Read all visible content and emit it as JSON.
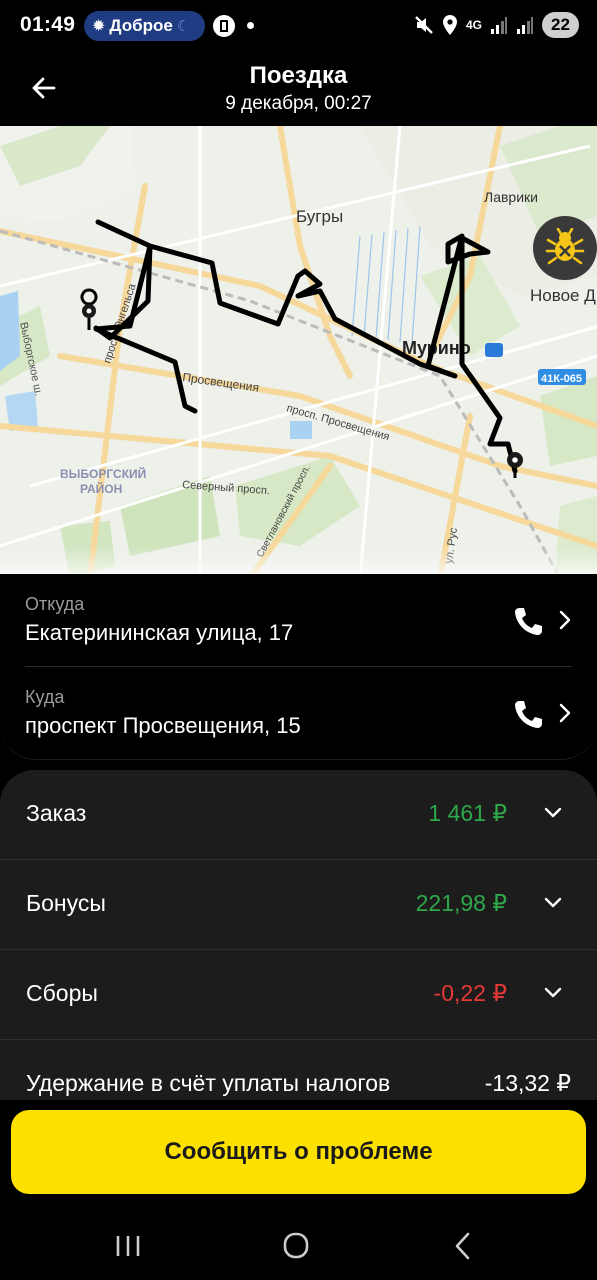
{
  "status_bar": {
    "time": "01:49",
    "notification_pill": "Доброе",
    "network": "4G",
    "battery": "22",
    "icons": [
      "sun-icon",
      "moon-icon",
      "app-notification-icon",
      "dot-icon",
      "mute-icon",
      "location-icon",
      "network-icon",
      "signal-icon",
      "signal-icon",
      "battery-icon"
    ]
  },
  "header": {
    "title": "Поездка",
    "subtitle": "9 декабря, 00:27",
    "back_icon": "arrow-left-icon"
  },
  "map": {
    "labels": {
      "bugry": "Бугры",
      "lavriki": "Лаврики",
      "novoe_devyatkino": "Новое Д",
      "murino": "Мурино",
      "road_41k": "41К-065",
      "vyborgskoe": "Выборгское ш.",
      "prosveshcheniya_1": "Просвещения",
      "prosveshcheniya_2": "просп. Просвещения",
      "district_1": "ВЫБОРГСКИЙ",
      "district_2": "РАЙОН",
      "severny": "Северный просп.",
      "svetlanovsky": "Светлановский просп.",
      "ul_rus": "ул. Рус",
      "engels": "просп. Энгельса"
    },
    "bug_icon": "bug-report-icon"
  },
  "route": {
    "from_label": "Откуда",
    "from_value": "Екатерининская улица, 17",
    "to_label": "Куда",
    "to_value": "проспект Просвещения, 15"
  },
  "payment": {
    "rows": [
      {
        "label": "Заказ",
        "amount": "1 461 ₽",
        "color": "#2ea84a"
      },
      {
        "label": "Бонусы",
        "amount": "221,98 ₽",
        "color": "#2ea84a"
      },
      {
        "label": "Сборы",
        "amount": "-0,22 ₽",
        "color": "#e53935"
      },
      {
        "label": "Удержание в счёт уплаты налогов",
        "amount": "-13,32 ₽",
        "color": "#ffffff"
      }
    ]
  },
  "actions": {
    "report_button": "Сообщить о проблеме"
  },
  "colors": {
    "accent_yellow": "#fce000",
    "positive": "#2ea84a",
    "negative": "#e53935",
    "card_bg": "#1c1c1c"
  }
}
